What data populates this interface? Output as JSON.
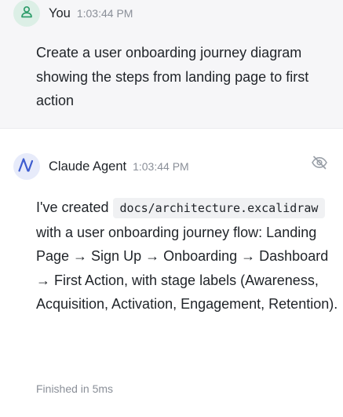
{
  "user_message": {
    "author": "You",
    "time": "1:03:44 PM",
    "icon": "person-icon",
    "text": "Create a user onboarding journey diagram showing the steps from landing page to first action"
  },
  "agent_message": {
    "author": "Claude Agent",
    "time": "1:03:44 PM",
    "icon": "claude-logo",
    "text_before": "I've created",
    "code": "docs/architecture.excalidraw",
    "text_after": "with a user onboarding journey flow: Landing Page → Sign Up → Onboarding → Dashboard → First Action, with stage labels (Awareness, Acquisition, Activation, Engagement, Retention).",
    "status": "Finished in 5ms",
    "hide_icon": "eye-off-icon"
  },
  "colors": {
    "user_avatar_bg": "#dcefe6",
    "user_avatar_fg": "#2f9d6b",
    "agent_avatar_bg": "#e7ebfa",
    "agent_avatar_fg": "#3d5ccf",
    "user_bubble_bg": "#f6f6f8"
  }
}
